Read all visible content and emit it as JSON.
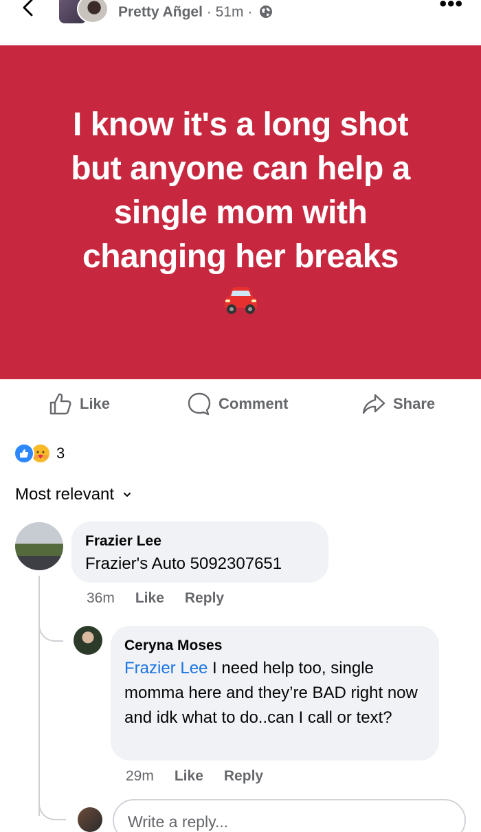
{
  "header": {
    "author_name": "Pretty Añgel",
    "separator": "·",
    "time": "51m",
    "back_icon": "chevron-left-icon",
    "more_icon": "more-dots-icon",
    "privacy_icon": "globe-icon"
  },
  "post": {
    "text": "I know it's a long shot\nbut anyone can help a\nsingle mom with\nchanging her  breaks",
    "emoji": "car-emoji",
    "background": "#c8283f"
  },
  "actions": {
    "like": "Like",
    "comment": "Comment",
    "share": "Share"
  },
  "reactions": {
    "count": "3",
    "icons": [
      "like-reaction-icon",
      "care-reaction-icon"
    ]
  },
  "sort": {
    "label": "Most relevant"
  },
  "comments": [
    {
      "name": "Frazier Lee",
      "text": "Frazier's Auto 5092307651",
      "time": "36m",
      "like": "Like",
      "reply": "Reply"
    },
    {
      "name": "Ceryna Moses",
      "mention": "Frazier Lee",
      "text": " I need help too, single momma here and they’re BAD right now and idk what to do..can I call or text?",
      "time": "29m",
      "like": "Like",
      "reply": "Reply"
    }
  ],
  "reply_box": {
    "placeholder": "Write a reply..."
  },
  "colors": {
    "accent": "#1b74e4",
    "muted": "#65676b",
    "bubble": "#f0f2f5"
  }
}
